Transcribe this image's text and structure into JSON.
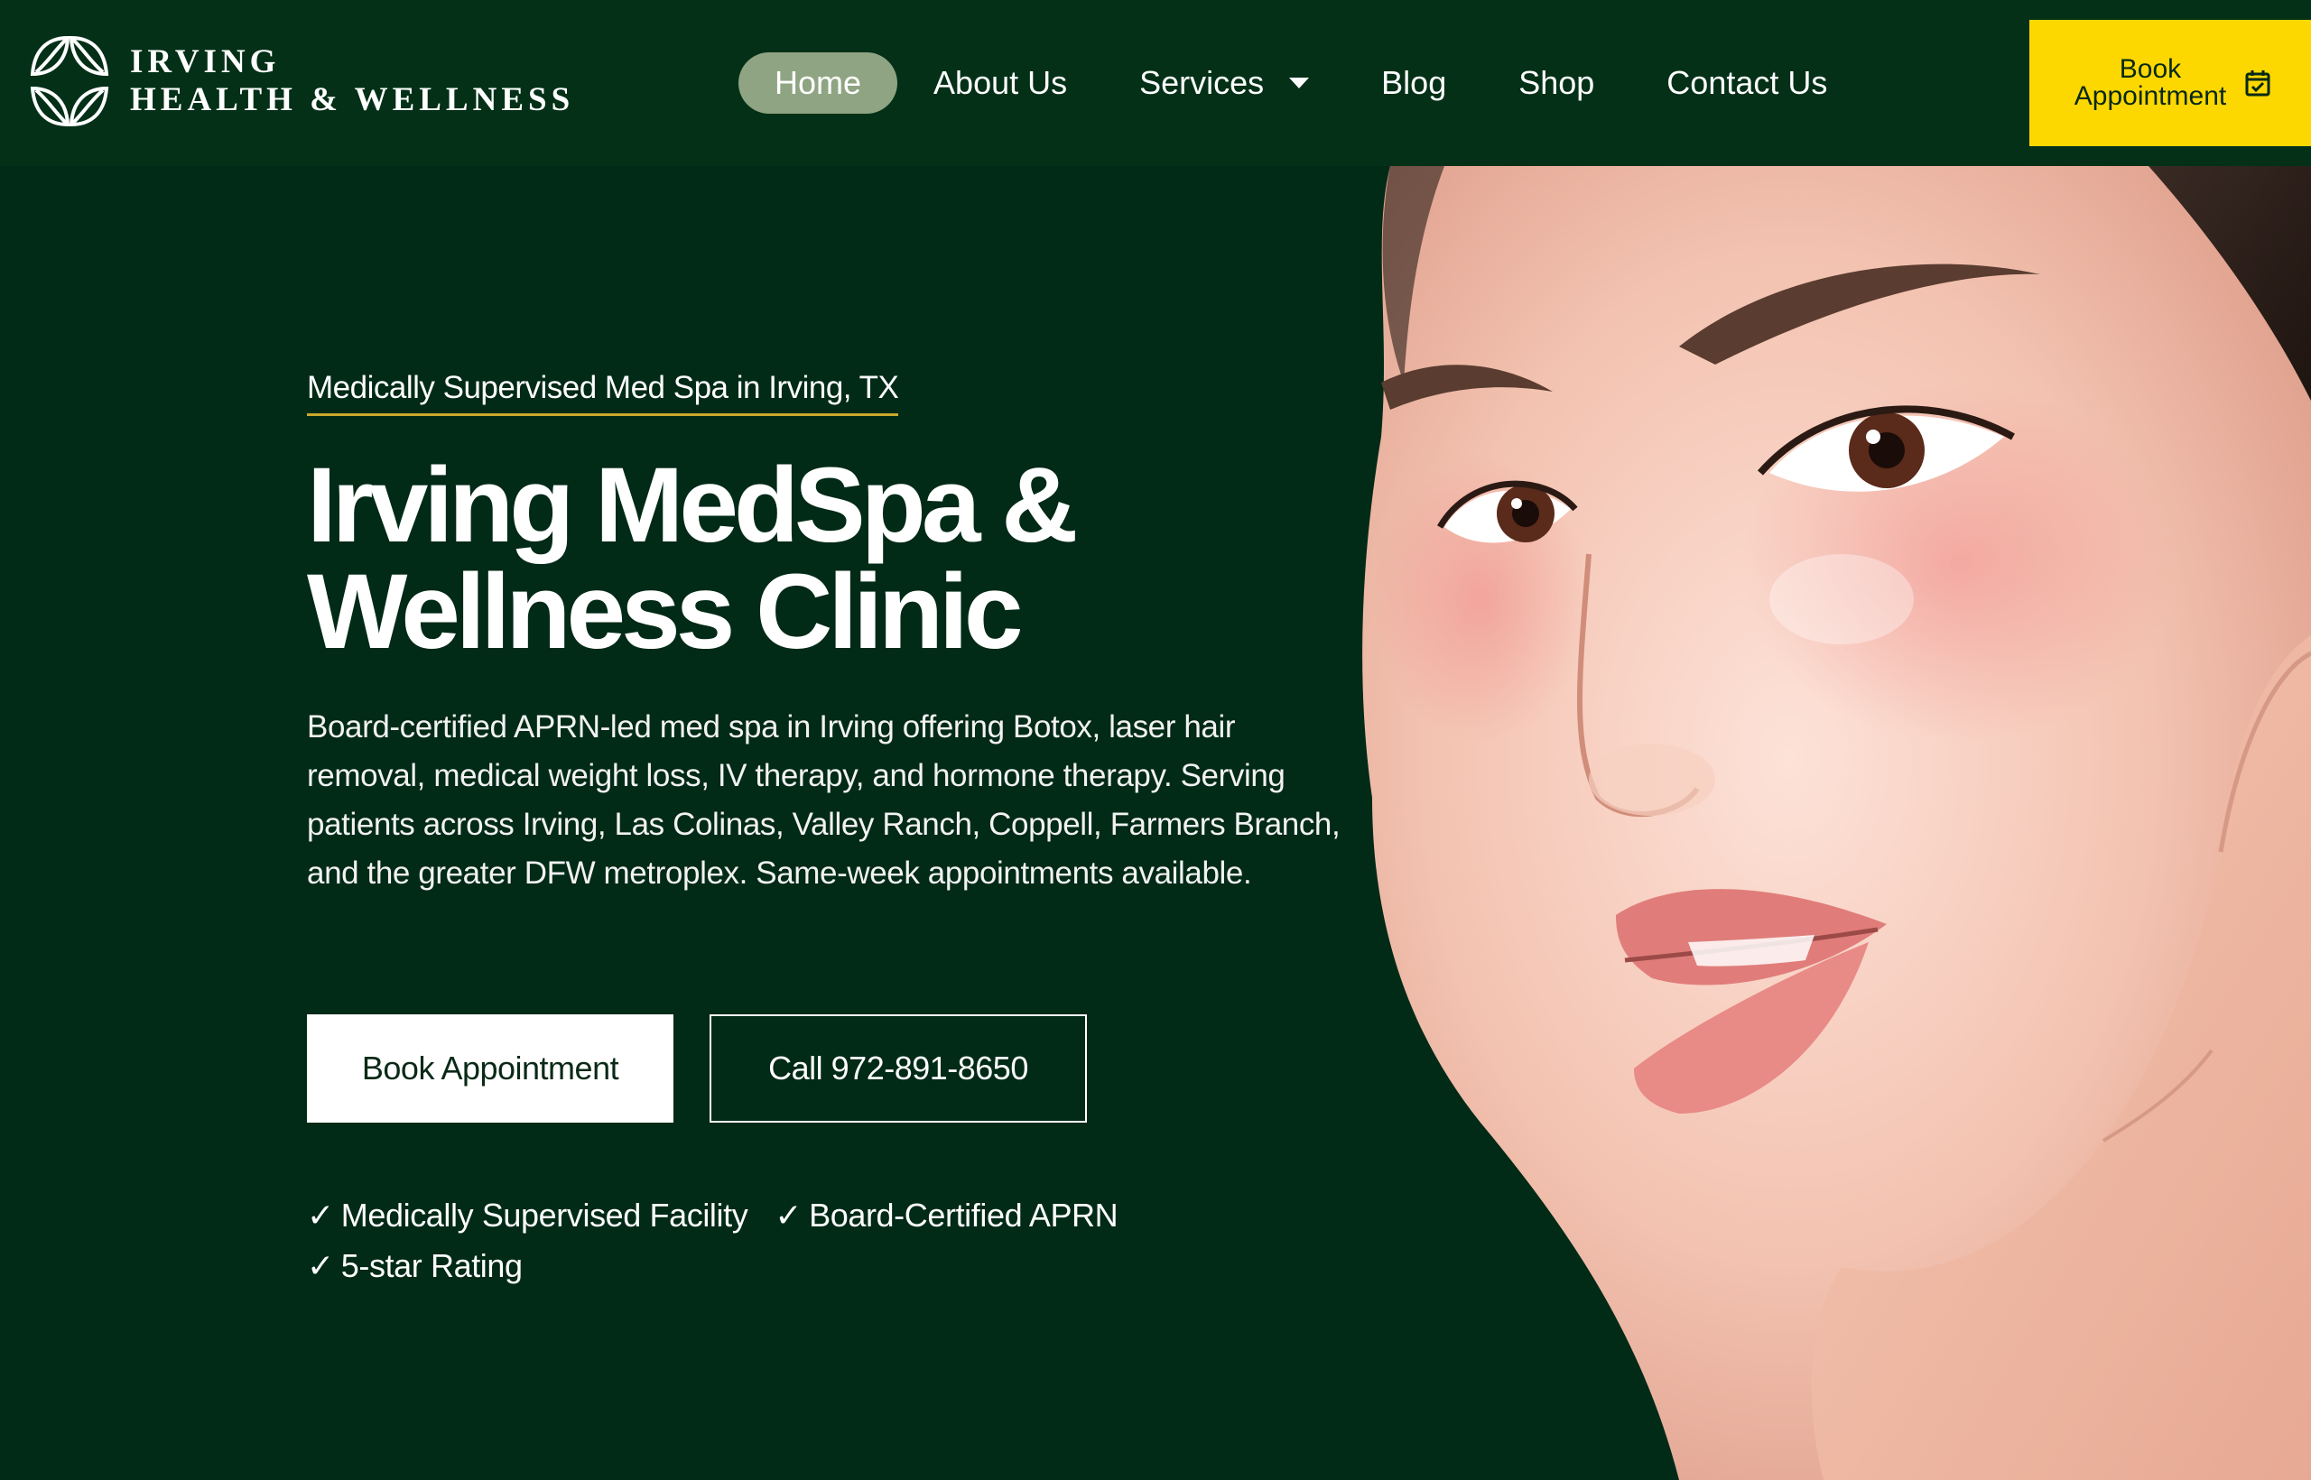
{
  "brand": {
    "line1": "IRVING",
    "line2": "HEALTH & WELLNESS"
  },
  "nav": {
    "items": [
      {
        "label": "Home",
        "active": true
      },
      {
        "label": "About Us",
        "active": false
      },
      {
        "label": "Services",
        "active": false,
        "has_dropdown": true
      },
      {
        "label": "Blog",
        "active": false
      },
      {
        "label": "Shop",
        "active": false
      },
      {
        "label": "Contact Us",
        "active": false
      }
    ]
  },
  "header_cta": {
    "label": "Book Appointment",
    "icon": "calendar-check-icon"
  },
  "hero": {
    "eyebrow": "Medically Supervised Med Spa in Irving, TX",
    "headline": "Irving MedSpa & Wellness Clinic",
    "description": "Board-certified APRN-led med spa in Irving offering Botox, laser hair removal, medical weight loss, IV therapy, and hormone therapy. Serving patients across Irving, Las Colinas, Valley Ranch, Coppell, Farmers Branch, and the greater DFW metroplex. Same-week appointments available.",
    "primary_button": "Book Appointment",
    "secondary_button": "Call 972-891-8650",
    "badges": [
      "Medically Supervised Facility",
      "Board-Certified APRN",
      "5-star Rating"
    ],
    "check_symbol": "✓"
  },
  "colors": {
    "background": "#012a17",
    "header": "#033017",
    "nav_active": "#8fa482",
    "cta_yellow": "#fdd700",
    "eyebrow_underline": "#c9a92e"
  }
}
